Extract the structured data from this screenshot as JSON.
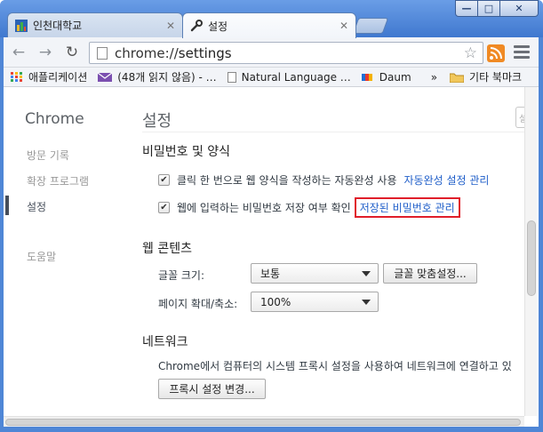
{
  "tabs": [
    {
      "label": "인천대학교",
      "active": false,
      "icon": "site-favicon"
    },
    {
      "label": "설정",
      "active": true,
      "icon": "wrench-icon"
    }
  ],
  "window_controls": {
    "minimize": "—",
    "maximize": "□",
    "close": "✕"
  },
  "address_bar": {
    "scheme": "chrome://",
    "host": "settings"
  },
  "bookmarks": [
    {
      "label": "애플리케이션",
      "icon": "apps-grid-icon"
    },
    {
      "label": "(48개 읽지 않음) - …",
      "icon": "mail-icon"
    },
    {
      "label": "Natural Language …",
      "icon": "page-icon"
    },
    {
      "label": "Daum",
      "icon": "daum-icon"
    },
    {
      "label": "»",
      "icon": "overflow-chevron"
    },
    {
      "label": "기타 북마크",
      "icon": "folder-icon"
    }
  ],
  "sidebar": {
    "brand": "Chrome",
    "items": [
      {
        "label": "방문 기록"
      },
      {
        "label": "확장 프로그램"
      },
      {
        "label": "설정"
      },
      {
        "label": "도움말"
      }
    ]
  },
  "page": {
    "title": "설정",
    "passwords": {
      "title": "비밀번호 및 양식",
      "autofill_label": "클릭 한 번으로 웹 양식을 작성하는 자동완성 사용",
      "autofill_link": "자동완성 설정 관리",
      "password_label": "웹에 입력하는 비밀번호 저장 여부 확인",
      "password_link": "저장된 비밀번호 관리",
      "checkmark": "✔"
    },
    "web_content": {
      "title": "웹 콘텐츠",
      "font_size_label": "글꼴 크기:",
      "font_size_value": "보통",
      "customize_fonts_button": "글꼴 맞춤설정...",
      "zoom_label": "페이지 확대/축소:",
      "zoom_value": "100%"
    },
    "network": {
      "title": "네트워크",
      "description": "Chrome에서 컴퓨터의 시스템 프록시 설정을 사용하여 네트워크에 연결하고 있",
      "proxy_button": "프록시 설정 변경..."
    }
  },
  "colors": {
    "link": "#1f5ec9",
    "highlight_border": "#e01e2a",
    "frame": "#4f86d6"
  }
}
